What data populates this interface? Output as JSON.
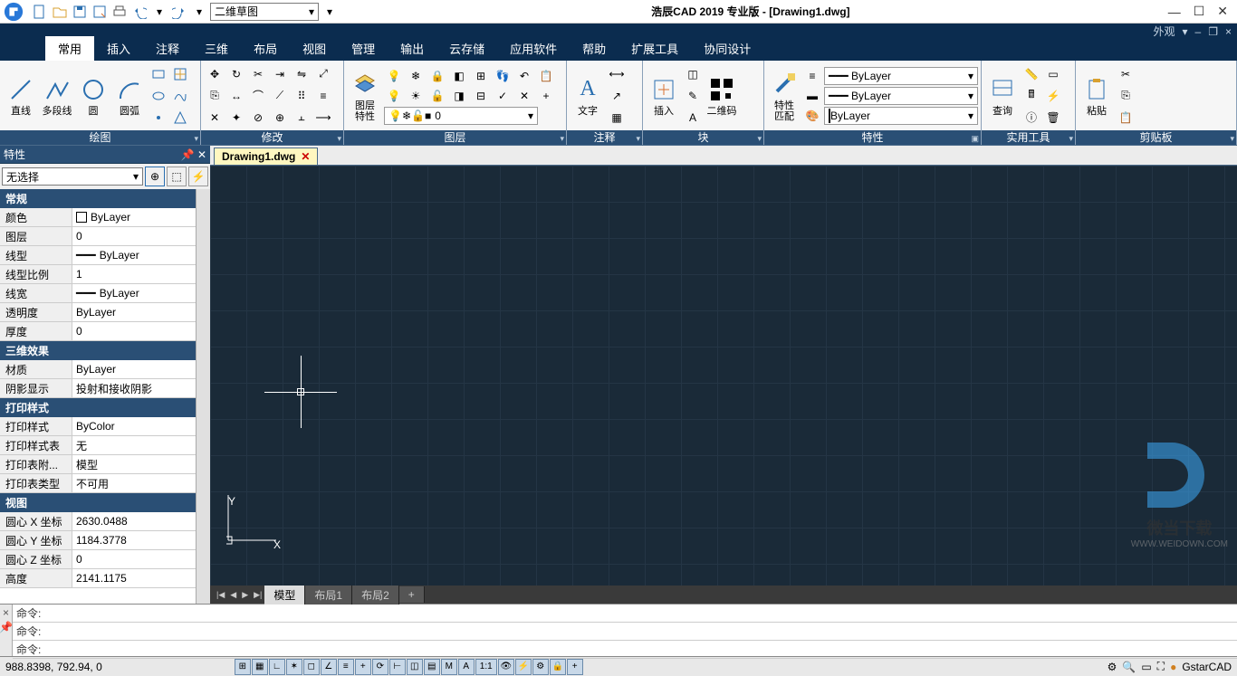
{
  "title": "浩辰CAD 2019 专业版 - [Drawing1.dwg]",
  "qat_dropdown": "二维草图",
  "skin_label": "外观",
  "tabs": [
    "常用",
    "插入",
    "注释",
    "三维",
    "布局",
    "视图",
    "管理",
    "输出",
    "云存储",
    "应用软件",
    "帮助",
    "扩展工具",
    "协同设计"
  ],
  "ribbon": {
    "draw": {
      "title": "绘图",
      "line": "直线",
      "pline": "多段线",
      "circle": "圆",
      "arc": "圆弧"
    },
    "modify": {
      "title": "修改"
    },
    "layer": {
      "title": "图层",
      "btn": "图层\n特性",
      "current": "0"
    },
    "annot": {
      "title": "注释",
      "text": "文字"
    },
    "block": {
      "title": "块",
      "insert": "插入",
      "qr": "二维码"
    },
    "props": {
      "title": "特性",
      "match": "特性\n匹配",
      "bylayer": "ByLayer"
    },
    "utils": {
      "title": "实用工具",
      "query": "查询"
    },
    "clip": {
      "title": "剪贴板",
      "paste": "粘贴"
    }
  },
  "prop_panel": {
    "title": "特性",
    "selection": "无选择",
    "groups": {
      "general": {
        "title": "常规",
        "color": "颜色",
        "color_v": "ByLayer",
        "layer": "图层",
        "layer_v": "0",
        "ltype": "线型",
        "ltype_v": "ByLayer",
        "ltscale": "线型比例",
        "ltscale_v": "1",
        "lweight": "线宽",
        "lweight_v": "ByLayer",
        "transp": "透明度",
        "transp_v": "ByLayer",
        "thick": "厚度",
        "thick_v": "0"
      },
      "threed": {
        "title": "三维效果",
        "mat": "材质",
        "mat_v": "ByLayer",
        "shadow": "阴影显示",
        "shadow_v": "投射和接收阴影"
      },
      "print": {
        "title": "打印样式",
        "pstyle": "打印样式",
        "pstyle_v": "ByColor",
        "ptable": "打印样式表",
        "ptable_v": "无",
        "pattach": "打印表附...",
        "pattach_v": "模型",
        "ptype": "打印表类型",
        "ptype_v": "不可用"
      },
      "view": {
        "title": "视图",
        "cx": "圆心 X 坐标",
        "cx_v": "2630.0488",
        "cy": "圆心 Y 坐标",
        "cy_v": "1184.3778",
        "cz": "圆心 Z 坐标",
        "cz_v": "0",
        "h": "高度",
        "h_v": "2141.1175"
      }
    }
  },
  "doc_tab": "Drawing1.dwg",
  "model_tabs": {
    "model": "模型",
    "layout1": "布局1",
    "layout2": "布局2"
  },
  "cmd": {
    "prompt": "命令:"
  },
  "status": {
    "coords": "988.8398, 792.94, 0",
    "scale": "1:1",
    "brand": "GstarCAD"
  },
  "ucs": {
    "x": "X",
    "y": "Y"
  },
  "watermark": {
    "text": "微当下载",
    "url": "WWW.WEIDOWN.COM"
  }
}
